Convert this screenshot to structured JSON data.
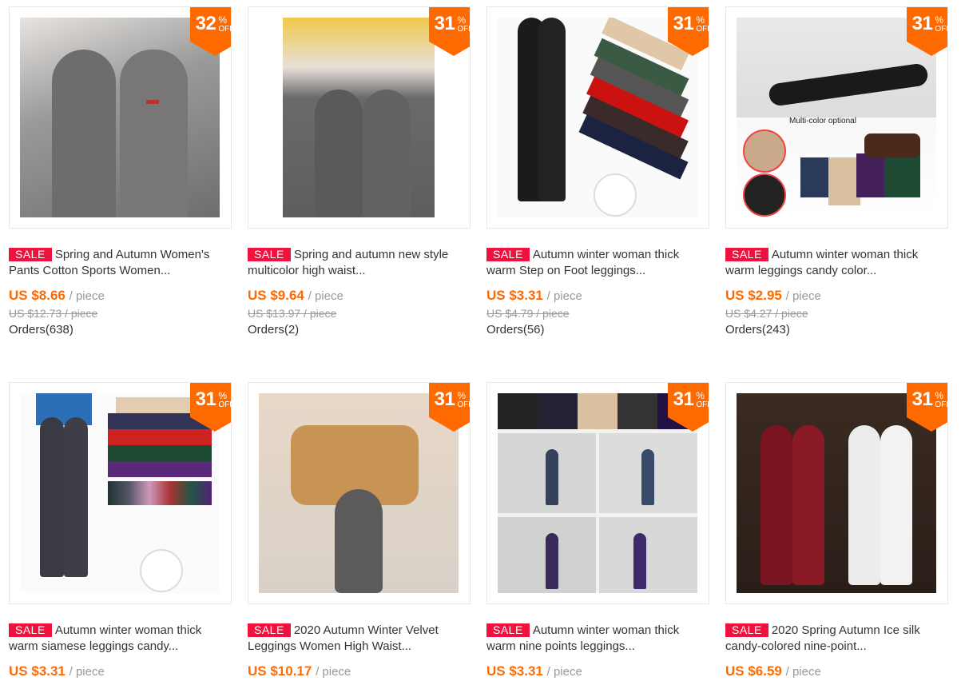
{
  "colors": {
    "badge": "#ff6a00",
    "sale": "#f0123e",
    "price": "#ff6a00"
  },
  "products": [
    {
      "discount": "32",
      "pct": "%",
      "off": "OFF",
      "sale": "SALE",
      "title": "Spring and Autumn Women's Pants Cotton Sports Women...",
      "price": "US $8.66",
      "unit": "/ piece",
      "original": "US $12.73 / piece",
      "orders": "Orders(638)"
    },
    {
      "discount": "31",
      "pct": "%",
      "off": "OFF",
      "sale": "SALE",
      "title": "Spring and autumn new style multicolor high waist...",
      "price": "US $9.64",
      "unit": "/ piece",
      "original": "US $13.97 / piece",
      "orders": "Orders(2)"
    },
    {
      "discount": "31",
      "pct": "%",
      "off": "OFF",
      "sale": "SALE",
      "title": "Autumn winter woman thick warm Step on Foot leggings...",
      "price": "US $3.31",
      "unit": "/ piece",
      "original": "US $4.79 / piece",
      "orders": "Orders(56)"
    },
    {
      "discount": "31",
      "pct": "%",
      "off": "OFF",
      "sale": "SALE",
      "title": "Autumn winter woman thick warm leggings candy color...",
      "price": "US $2.95",
      "unit": "/ piece",
      "original": "US $4.27 / piece",
      "orders": "Orders(243)",
      "img_text": "Multi-color optional"
    },
    {
      "discount": "31",
      "pct": "%",
      "off": "OFF",
      "sale": "SALE",
      "title": "Autumn winter woman thick warm siamese leggings candy...",
      "price": "US $3.31",
      "unit": "/ piece"
    },
    {
      "discount": "31",
      "pct": "%",
      "off": "OFF",
      "sale": "SALE",
      "title": "2020 Autumn Winter Velvet Leggings Women High Waist...",
      "price": "US $10.17",
      "unit": "/ piece"
    },
    {
      "discount": "31",
      "pct": "%",
      "off": "OFF",
      "sale": "SALE",
      "title": "Autumn winter woman thick warm nine points leggings...",
      "price": "US $3.31",
      "unit": "/ piece"
    },
    {
      "discount": "31",
      "pct": "%",
      "off": "OFF",
      "sale": "SALE",
      "title": "2020 Spring Autumn Ice silk candy-colored nine-point...",
      "price": "US $6.59",
      "unit": "/ piece"
    }
  ]
}
